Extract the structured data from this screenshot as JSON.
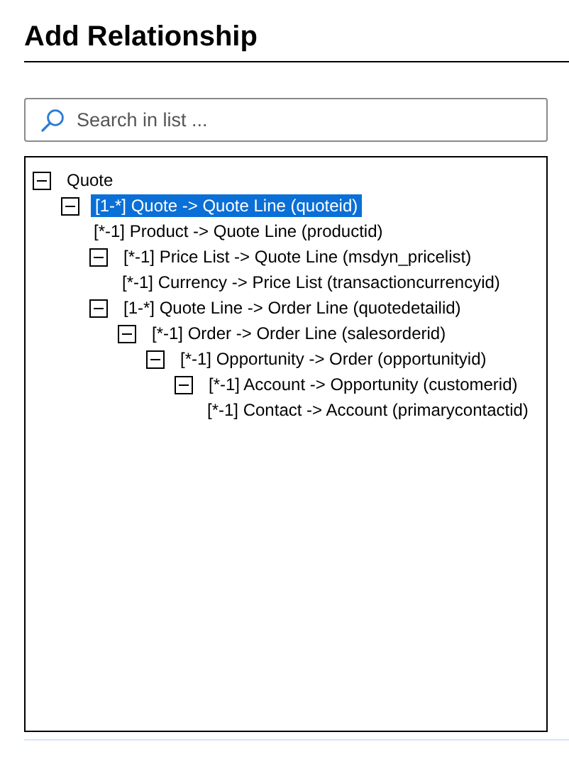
{
  "title": "Add Relationship",
  "search": {
    "placeholder": "Search in list ..."
  },
  "tree": [
    {
      "label": "Quote",
      "expanded": true,
      "selected": false,
      "children": [
        {
          "label": "[1-*] Quote -> Quote Line (quoteid)",
          "expanded": true,
          "selected": true,
          "children": [
            {
              "label": "[*-1] Product -> Quote Line (productid)",
              "selected": false
            },
            {
              "label": "[*-1] Price List -> Quote Line (msdyn_pricelist)",
              "expanded": true,
              "selected": false,
              "children": [
                {
                  "label": "[*-1] Currency -> Price List (transactioncurrencyid)",
                  "selected": false
                }
              ]
            },
            {
              "label": "[1-*] Quote Line -> Order Line (quotedetailid)",
              "expanded": true,
              "selected": false,
              "children": [
                {
                  "label": "[*-1] Order -> Order Line (salesorderid)",
                  "expanded": true,
                  "selected": false,
                  "children": [
                    {
                      "label": "[*-1] Opportunity -> Order (opportunityid)",
                      "expanded": true,
                      "selected": false,
                      "children": [
                        {
                          "label": "[*-1] Account -> Opportunity (customerid)",
                          "expanded": true,
                          "selected": false,
                          "children": [
                            {
                              "label": "[*-1] Contact -> Account (primarycontactid)",
                              "selected": false
                            }
                          ]
                        }
                      ]
                    }
                  ]
                }
              ]
            }
          ]
        }
      ]
    }
  ]
}
